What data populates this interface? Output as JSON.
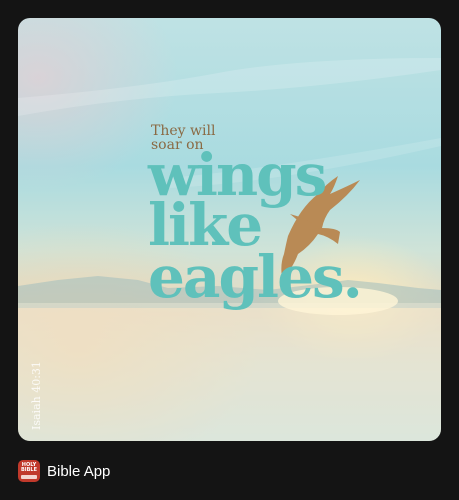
{
  "verse_card": {
    "line1": "They will",
    "line2": "soar on",
    "word1": "wings",
    "word2": "like",
    "word3": "eagles.",
    "reference": "Isaiah 40:31"
  },
  "app": {
    "icon_text": "HOLY BIBLE",
    "name": "Bible App"
  },
  "colors": {
    "background": "#141414",
    "accent_teal": "#5fc1bb",
    "small_text_brown": "#8a6a44",
    "icon_red": "#c0392b"
  }
}
